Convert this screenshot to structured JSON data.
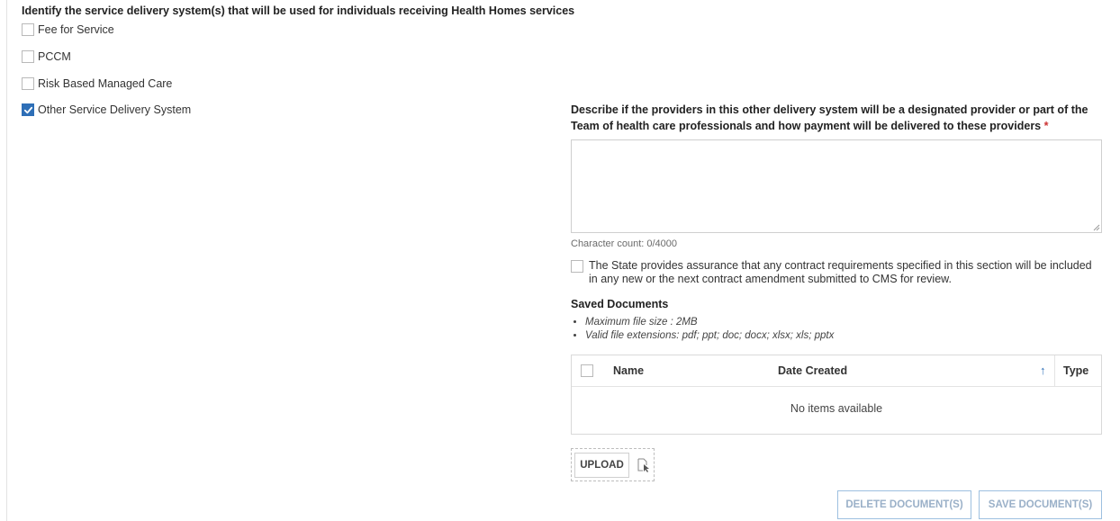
{
  "question": "Identify the service delivery system(s) that will be used for individuals receiving Health Homes services",
  "options": [
    {
      "label": "Fee for Service",
      "checked": false
    },
    {
      "label": "PCCM",
      "checked": false
    },
    {
      "label": "Risk Based Managed Care",
      "checked": false
    },
    {
      "label": "Other Service Delivery System",
      "checked": true
    }
  ],
  "other_section": {
    "description_label": "Describe if the providers in this other delivery system will be a designated provider or part of the Team of health care professionals and how payment will be delivered to these providers",
    "required_marker": "*",
    "description_value": "",
    "character_count": "Character count: 0/4000",
    "assurance_text": "The State provides assurance that any contract requirements specified in this section will be included in any new or the next contract amendment submitted to CMS for review.",
    "assurance_checked": false
  },
  "documents": {
    "title": "Saved Documents",
    "notes": [
      "Maximum file size : 2MB",
      "Valid file extensions: pdf; ppt; doc; docx; xlsx; xls; pptx"
    ],
    "columns": {
      "name": "Name",
      "date_created": "Date Created",
      "type": "Type"
    },
    "sort_icon": "arrow-up-icon",
    "empty_text": "No items available",
    "upload_label": "UPLOAD",
    "delete_label": "DELETE DOCUMENT(S)",
    "save_label": "SAVE DOCUMENT(S)"
  },
  "colors": {
    "accent": "#2e6fb7",
    "required": "#cc3333",
    "disabled_text": "#9ab0c8"
  }
}
